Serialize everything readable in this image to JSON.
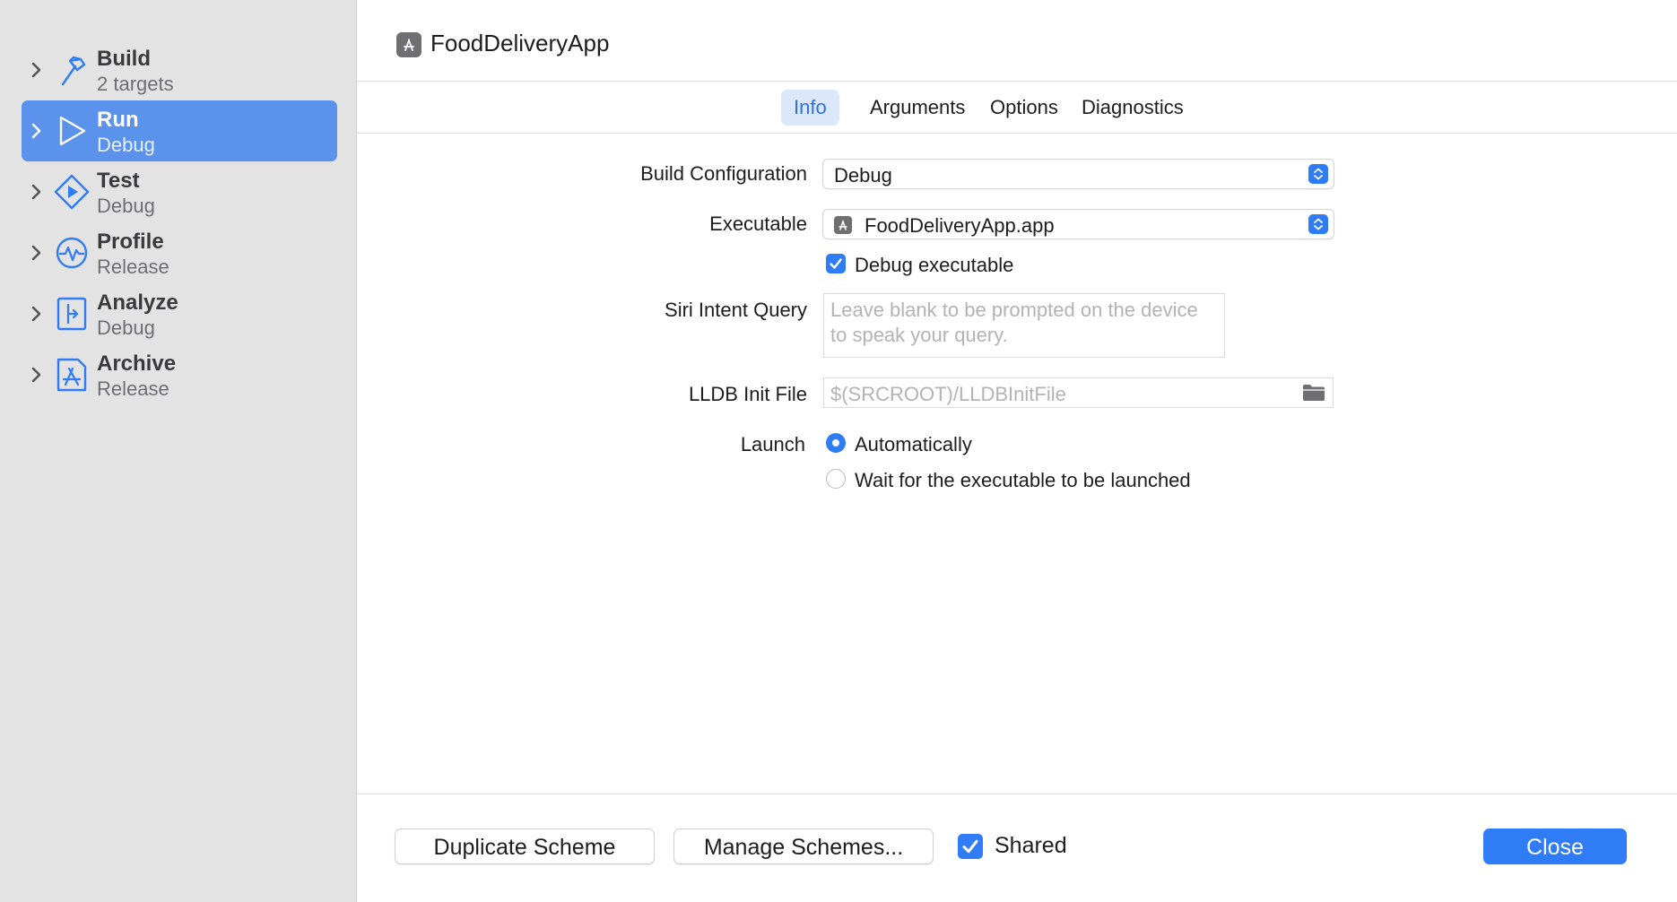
{
  "sidebar": {
    "items": [
      {
        "title": "Build",
        "subtitle": "2 targets",
        "icon": "hammer-icon"
      },
      {
        "title": "Run",
        "subtitle": "Debug",
        "icon": "play-icon",
        "selected": true
      },
      {
        "title": "Test",
        "subtitle": "Debug",
        "icon": "diamond-play-icon"
      },
      {
        "title": "Profile",
        "subtitle": "Release",
        "icon": "waveform-icon"
      },
      {
        "title": "Analyze",
        "subtitle": "Debug",
        "icon": "analyze-icon"
      },
      {
        "title": "Archive",
        "subtitle": "Release",
        "icon": "app-store-icon"
      }
    ]
  },
  "header": {
    "title": "FoodDeliveryApp"
  },
  "tabs": [
    {
      "label": "Info",
      "active": true
    },
    {
      "label": "Arguments"
    },
    {
      "label": "Options"
    },
    {
      "label": "Diagnostics"
    }
  ],
  "form": {
    "build_configuration": {
      "label": "Build Configuration",
      "value": "Debug"
    },
    "executable": {
      "label": "Executable",
      "value": "FoodDeliveryApp.app"
    },
    "debug_executable": {
      "label": "Debug executable",
      "checked": true
    },
    "siri_intent_query": {
      "label": "Siri Intent Query",
      "placeholder": "Leave blank to be prompted on the device to speak your query."
    },
    "lldb_init_file": {
      "label": "LLDB Init File",
      "placeholder": "$(SRCROOT)/LLDBInitFile"
    },
    "launch": {
      "label": "Launch",
      "options": [
        "Automatically",
        "Wait for the executable to be launched"
      ],
      "selected": "Automatically"
    }
  },
  "footer": {
    "duplicate_label": "Duplicate Scheme",
    "manage_label": "Manage Schemes...",
    "shared_label": "Shared",
    "shared_checked": true,
    "close_label": "Close"
  },
  "colors": {
    "accent": "#2f7cf6",
    "selected_row": "#5b93ec",
    "sidebar_bg": "#e3e3e3"
  }
}
